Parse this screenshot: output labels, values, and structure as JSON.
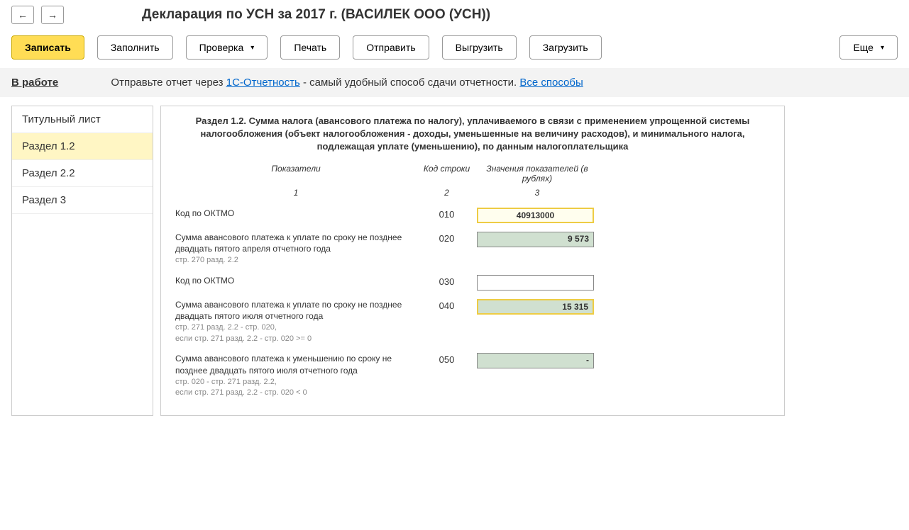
{
  "header": {
    "title": "Декларация по УСН за 2017 г. (ВАСИЛЕК ООО (УСН))"
  },
  "toolbar": {
    "save": "Записать",
    "fill": "Заполнить",
    "check": "Проверка",
    "print": "Печать",
    "send": "Отправить",
    "export": "Выгрузить",
    "import": "Загрузить",
    "more": "Еще"
  },
  "info_bar": {
    "status": "В работе",
    "text_before": "Отправьте отчет через ",
    "link1": "1С-Отчетность",
    "text_middle": " - самый удобный способ сдачи отчетности. ",
    "link2": "Все способы"
  },
  "sidebar": {
    "items": [
      {
        "label": "Титульный лист"
      },
      {
        "label": "Раздел 1.2"
      },
      {
        "label": "Раздел 2.2"
      },
      {
        "label": "Раздел 3"
      }
    ]
  },
  "section": {
    "title": "Раздел 1.2. Сумма налога (авансового платежа по налогу), уплачиваемого в связи с применением упрощенной системы налогообложения (объект налогообложения - доходы, уменьшенные на величину расходов), и минимального налога, подлежащая уплате (уменьшению), по данным налогоплательщика",
    "col_headers": {
      "c1": "Показатели",
      "c2": "Код строки",
      "c3": "Значения показателей (в рублях)",
      "n1": "1",
      "n2": "2",
      "n3": "3"
    },
    "rows": [
      {
        "label": "Код по ОКТМО",
        "sub": "",
        "code": "010",
        "value": "40913000",
        "style": "yellow-border"
      },
      {
        "label": "Сумма авансового платежа к уплате по сроку не позднее двадцать пятого апреля отчетного года",
        "sub": "стр. 270 разд. 2.2",
        "code": "020",
        "value": "9 573",
        "style": "green"
      },
      {
        "label": "Код по ОКТМО",
        "sub": "",
        "code": "030",
        "value": "",
        "style": "plain"
      },
      {
        "label": "Сумма  авансового платежа к уплате по сроку не позднее двадцать пятого июля отчетного года",
        "sub": "стр. 271 разд. 2.2 - стр. 020,\nесли стр. 271 разд. 2.2 - стр. 020 >= 0",
        "code": "040",
        "value": "15 315",
        "style": "green-yellow"
      },
      {
        "label": "Сумма авансового платежа к уменьшению по сроку не позднее двадцать пятого июля отчетного года",
        "sub": "стр. 020 - стр. 271 разд. 2.2,\nесли стр. 271 разд. 2.2 - стр. 020 < 0",
        "code": "050",
        "value": "-",
        "style": "green dash"
      }
    ]
  }
}
